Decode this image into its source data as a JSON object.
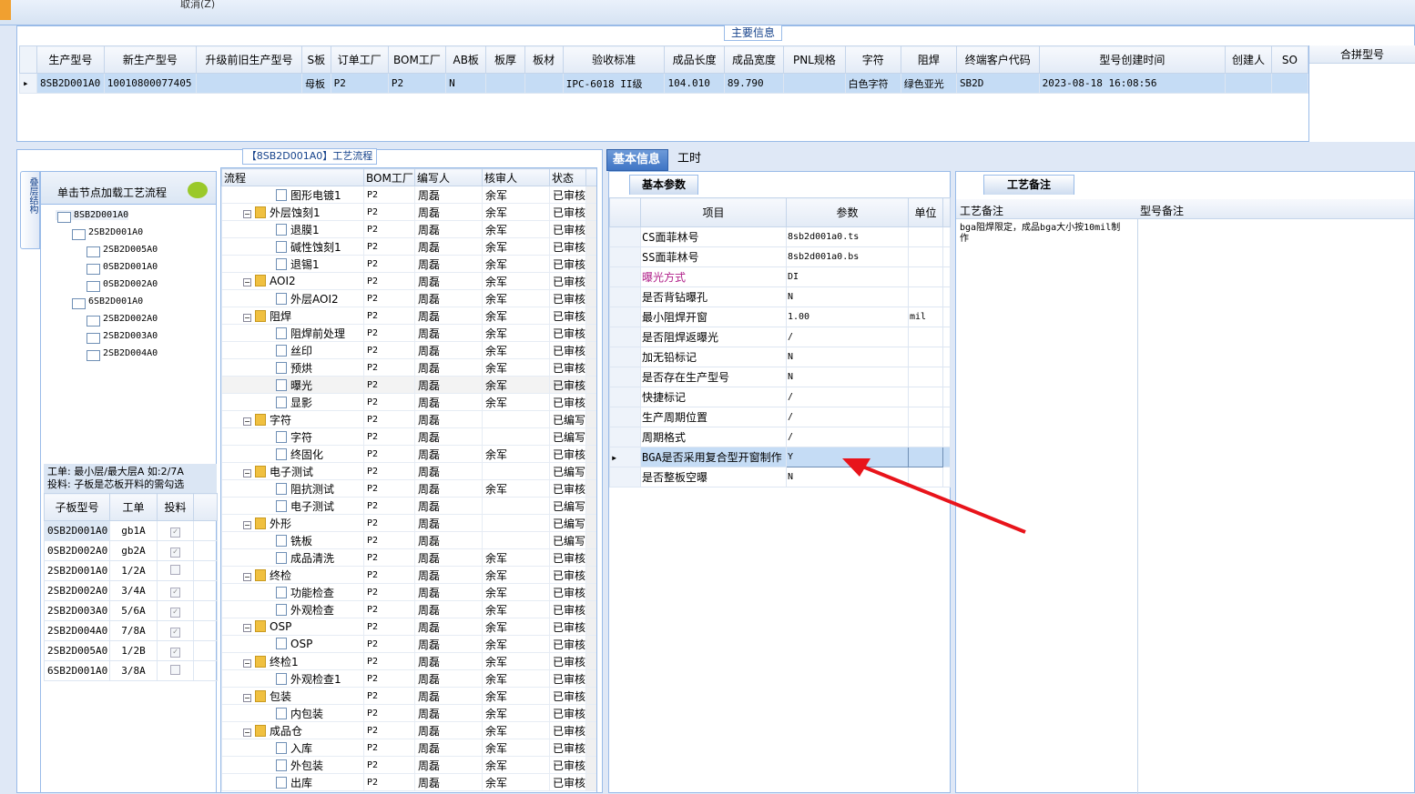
{
  "toolbar": {
    "cancel_label": "取消(Z)"
  },
  "main_info": {
    "title": "主要信息",
    "columns": [
      "生产型号",
      "新生产型号",
      "升级前旧生产型号",
      "S板",
      "订单工厂",
      "BOM工厂",
      "AB板",
      "板厚",
      "板材",
      "验收标准",
      "成品长度",
      "成品宽度",
      "PNL规格",
      "字符",
      "阻焊",
      "终端客户代码",
      "型号创建时间",
      "创建人",
      "SO"
    ],
    "row": [
      "8SB2D001A0",
      "10010800077405",
      "",
      "母板",
      "P2",
      "P2",
      "N",
      "",
      "",
      "IPC-6018 II级",
      "104.010",
      "89.790",
      "",
      "白色字符",
      "绿色亚光",
      "SB2D",
      "2023-08-18 16:08:56",
      "",
      ""
    ],
    "merge_header": "合拼型号"
  },
  "structure": {
    "tab_label": "叠层结构",
    "hint": "单击节点加载工艺流程",
    "tree": [
      {
        "label": "8SB2D001A0",
        "level": 0,
        "sel": true
      },
      {
        "label": "2SB2D001A0",
        "level": 1
      },
      {
        "label": "2SB2D005A0",
        "level": 2
      },
      {
        "label": "0SB2D001A0",
        "level": 2
      },
      {
        "label": "0SB2D002A0",
        "level": 2
      },
      {
        "label": "6SB2D001A0",
        "level": 1
      },
      {
        "label": "2SB2D002A0",
        "level": 2
      },
      {
        "label": "2SB2D003A0",
        "level": 2
      },
      {
        "label": "2SB2D004A0",
        "level": 2
      }
    ],
    "note_line1": "工单: 最小层/最大层A 如:2/7A",
    "note_line2": "投料: 子板是芯板开料的需勾选",
    "sub_columns": [
      "子板型号",
      "工单",
      "投料"
    ],
    "sub_rows": [
      [
        "0SB2D001A0",
        "gb1A",
        "✓"
      ],
      [
        "0SB2D002A0",
        "gb2A",
        "✓"
      ],
      [
        "2SB2D001A0",
        "1/2A",
        ""
      ],
      [
        "2SB2D002A0",
        "3/4A",
        "✓"
      ],
      [
        "2SB2D003A0",
        "5/6A",
        "✓"
      ],
      [
        "2SB2D004A0",
        "7/8A",
        "✓"
      ],
      [
        "2SB2D005A0",
        "1/2B",
        "✓"
      ],
      [
        "6SB2D001A0",
        "3/8A",
        ""
      ]
    ]
  },
  "flow": {
    "title": "【8SB2D001A0】工艺流程",
    "columns": [
      "流程",
      "BOM工厂",
      "编写人",
      "核审人",
      "状态"
    ],
    "rows": [
      {
        "name": "图形电镀1",
        "type": "doc",
        "bom": "P2",
        "w": "周磊",
        "r": "余军",
        "s": "已审核"
      },
      {
        "name": "外层蚀刻1",
        "type": "folder",
        "bom": "P2",
        "w": "周磊",
        "r": "余军",
        "s": "已审核"
      },
      {
        "name": "退膜1",
        "type": "doc",
        "bom": "P2",
        "w": "周磊",
        "r": "余军",
        "s": "已审核"
      },
      {
        "name": "碱性蚀刻1",
        "type": "doc",
        "bom": "P2",
        "w": "周磊",
        "r": "余军",
        "s": "已审核"
      },
      {
        "name": "退锡1",
        "type": "doc",
        "bom": "P2",
        "w": "周磊",
        "r": "余军",
        "s": "已审核"
      },
      {
        "name": "AOI2",
        "type": "folder",
        "bom": "P2",
        "w": "周磊",
        "r": "余军",
        "s": "已审核"
      },
      {
        "name": "外层AOI2",
        "type": "doc",
        "bom": "P2",
        "w": "周磊",
        "r": "余军",
        "s": "已审核"
      },
      {
        "name": "阻焊",
        "type": "folder",
        "bom": "P2",
        "w": "周磊",
        "r": "余军",
        "s": "已审核"
      },
      {
        "name": "阻焊前处理",
        "type": "doc",
        "bom": "P2",
        "w": "周磊",
        "r": "余军",
        "s": "已审核"
      },
      {
        "name": "丝印",
        "type": "doc",
        "bom": "P2",
        "w": "周磊",
        "r": "余军",
        "s": "已审核"
      },
      {
        "name": "预烘",
        "type": "doc",
        "bom": "P2",
        "w": "周磊",
        "r": "余军",
        "s": "已审核"
      },
      {
        "name": "曝光",
        "type": "doc",
        "bom": "P2",
        "w": "周磊",
        "r": "余军",
        "s": "已审核",
        "sel": true
      },
      {
        "name": "显影",
        "type": "doc",
        "bom": "P2",
        "w": "周磊",
        "r": "余军",
        "s": "已审核"
      },
      {
        "name": "字符",
        "type": "folder",
        "bom": "P2",
        "w": "周磊",
        "r": "",
        "s": "已编写"
      },
      {
        "name": "字符",
        "type": "doc",
        "bom": "P2",
        "w": "周磊",
        "r": "",
        "s": "已编写"
      },
      {
        "name": "终固化",
        "type": "doc",
        "bom": "P2",
        "w": "周磊",
        "r": "余军",
        "s": "已审核"
      },
      {
        "name": "电子测试",
        "type": "folder",
        "bom": "P2",
        "w": "周磊",
        "r": "",
        "s": "已编写"
      },
      {
        "name": "阻抗测试",
        "type": "doc",
        "bom": "P2",
        "w": "周磊",
        "r": "余军",
        "s": "已审核"
      },
      {
        "name": "电子测试",
        "type": "doc",
        "bom": "P2",
        "w": "周磊",
        "r": "",
        "s": "已编写"
      },
      {
        "name": "外形",
        "type": "folder",
        "bom": "P2",
        "w": "周磊",
        "r": "",
        "s": "已编写"
      },
      {
        "name": "铣板",
        "type": "doc",
        "bom": "P2",
        "w": "周磊",
        "r": "",
        "s": "已编写"
      },
      {
        "name": "成品清洗",
        "type": "doc",
        "bom": "P2",
        "w": "周磊",
        "r": "余军",
        "s": "已审核"
      },
      {
        "name": "终检",
        "type": "folder",
        "bom": "P2",
        "w": "周磊",
        "r": "余军",
        "s": "已审核"
      },
      {
        "name": "功能检查",
        "type": "doc",
        "bom": "P2",
        "w": "周磊",
        "r": "余军",
        "s": "已审核"
      },
      {
        "name": "外观检查",
        "type": "doc",
        "bom": "P2",
        "w": "周磊",
        "r": "余军",
        "s": "已审核"
      },
      {
        "name": "OSP",
        "type": "folder",
        "bom": "P2",
        "w": "周磊",
        "r": "余军",
        "s": "已审核"
      },
      {
        "name": "OSP",
        "type": "doc",
        "bom": "P2",
        "w": "周磊",
        "r": "余军",
        "s": "已审核"
      },
      {
        "name": "终检1",
        "type": "folder",
        "bom": "P2",
        "w": "周磊",
        "r": "余军",
        "s": "已审核"
      },
      {
        "name": "外观检查1",
        "type": "doc",
        "bom": "P2",
        "w": "周磊",
        "r": "余军",
        "s": "已审核"
      },
      {
        "name": "包装",
        "type": "folder",
        "bom": "P2",
        "w": "周磊",
        "r": "余军",
        "s": "已审核"
      },
      {
        "name": "内包装",
        "type": "doc",
        "bom": "P2",
        "w": "周磊",
        "r": "余军",
        "s": "已审核"
      },
      {
        "name": "成品仓",
        "type": "folder",
        "bom": "P2",
        "w": "周磊",
        "r": "余军",
        "s": "已审核"
      },
      {
        "name": "入库",
        "type": "doc",
        "bom": "P2",
        "w": "周磊",
        "r": "余军",
        "s": "已审核"
      },
      {
        "name": "外包装",
        "type": "doc",
        "bom": "P2",
        "w": "周磊",
        "r": "余军",
        "s": "已审核"
      },
      {
        "name": "出库",
        "type": "doc",
        "bom": "P2",
        "w": "周磊",
        "r": "余军",
        "s": "已审核"
      }
    ]
  },
  "right": {
    "tab_basic": "基本信息",
    "tab_hours": "工时",
    "subtab_params": "基本参数",
    "param_columns": [
      "项目",
      "参数",
      "单位"
    ],
    "params": [
      {
        "item": "CS面菲林号",
        "val": "8sb2d001a0.ts",
        "unit": ""
      },
      {
        "item": "SS面菲林号",
        "val": "8sb2d001a0.bs",
        "unit": ""
      },
      {
        "item": "曝光方式",
        "val": "DI",
        "unit": "",
        "hl": true
      },
      {
        "item": "是否背钻曝孔",
        "val": "N",
        "unit": ""
      },
      {
        "item": "最小阻焊开窗",
        "val": "1.00",
        "unit": "mil"
      },
      {
        "item": "是否阻焊返曝光",
        "val": "/",
        "unit": ""
      },
      {
        "item": "加无铅标记",
        "val": "N",
        "unit": ""
      },
      {
        "item": "是否存在生产型号",
        "val": "N",
        "unit": ""
      },
      {
        "item": "快捷标记",
        "val": "/",
        "unit": ""
      },
      {
        "item": "生产周期位置",
        "val": "/",
        "unit": ""
      },
      {
        "item": "周期格式",
        "val": "/",
        "unit": ""
      },
      {
        "item": "BGA是否采用复合型开窗制作",
        "val": "Y",
        "unit": "",
        "sel": true
      },
      {
        "item": "是否整板空曝",
        "val": "N",
        "unit": ""
      }
    ],
    "subtab_memo": "工艺备注",
    "memo_col1": "工艺备注",
    "memo_col2": "型号备注",
    "memo_text": "bga阻焊限定，成品bga大小按10mil制作"
  },
  "colors": {
    "accent": "#3f75c5",
    "arrow": "#e8141b"
  }
}
